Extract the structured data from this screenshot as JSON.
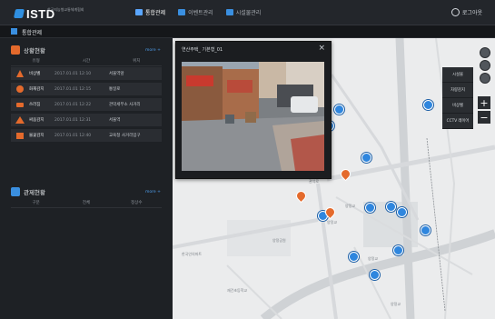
{
  "app": {
    "logo_text": "ISTD",
    "logo_subtitle": "한국지능형교통체계협회",
    "colors": {
      "accent": "#3a8fe0",
      "alert": "#e46a2c",
      "bg": "#1b1d21"
    }
  },
  "topnav": {
    "items": [
      {
        "label": "통합관제",
        "icon": "monitor-icon"
      },
      {
        "label": "이벤트관리",
        "icon": "list-icon"
      },
      {
        "label": "시설물관리",
        "icon": "facility-icon"
      }
    ],
    "logout_label": "로그아웃"
  },
  "subbar": {
    "title": "통합관제"
  },
  "left": {
    "incidents": {
      "title": "상황현황",
      "more": "more +",
      "columns": [
        "유형",
        "시간",
        "위치"
      ],
      "rows": [
        {
          "name": "비상벨",
          "time": "2017.01.01 12:10",
          "loc": "서울역앞"
        },
        {
          "name": "화재감지",
          "time": "2017.01.01 12:15",
          "loc": "통일로"
        },
        {
          "name": "쓰러짐",
          "time": "2017.01.01 12:22",
          "loc": "관악세무소 사거리"
        },
        {
          "name": "싸움감지",
          "time": "2017.01.01 12:31",
          "loc": "서울역"
        },
        {
          "name": "불꽃감지",
          "time": "2017.01.01 12:40",
          "loc": "교육청 사거리입구"
        }
      ]
    },
    "cctv": {
      "title": "관제현황",
      "more": "more +",
      "columns": [
        "구분",
        "전체",
        "정상수"
      ]
    }
  },
  "popup": {
    "title": "연산주택_ 기본형_01",
    "close": "×"
  },
  "map_controls": {
    "layers": [
      "시설물",
      "차량감지",
      "비상벨",
      "CCTV 레이어"
    ],
    "zoom_in": "+",
    "zoom_out": "−"
  },
  "map_labels": {
    "a": "관악로",
    "b": "양정교",
    "c": "양정교",
    "d": "양정교",
    "e": "한국인의파트",
    "f": "재건초등학교",
    "g": "양정교",
    "h": "양정공원"
  }
}
